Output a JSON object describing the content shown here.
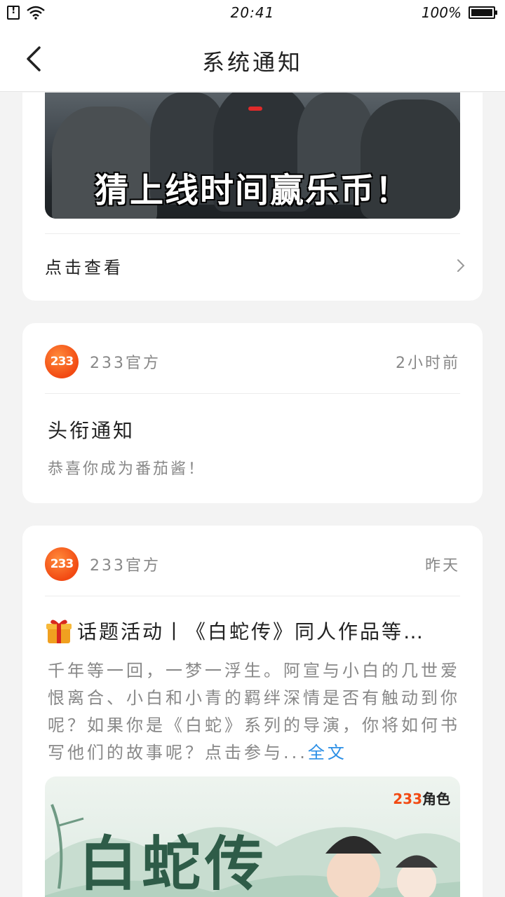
{
  "status_bar": {
    "time": "20:41",
    "battery": "100%"
  },
  "header": {
    "title": "系统通知"
  },
  "card1": {
    "banner_caption": "猜上线时间赢乐币！",
    "view_label": "点击查看"
  },
  "messages": [
    {
      "logo": "233",
      "sender": "233官方",
      "time": "2小时前",
      "title": "头衔通知",
      "body": "恭喜你成为番茄酱！"
    },
    {
      "logo": "233",
      "sender": "233官方",
      "time": "昨天",
      "title": "话题活动丨《白蛇传》同人作品等…",
      "body": "千年等一回，一梦一浮生。阿宣与小白的几世爱恨离合、小白和小青的羁绊深情是否有触动到你呢？如果你是《白蛇》系列的导演，你将如何书写他们的故事呢？点击参与...",
      "fulltext_label": "全文",
      "banner_brand_num": "233",
      "banner_brand_txt": "角色",
      "banner_text": "白蛇传"
    }
  ],
  "colors": {
    "accent_link": "#2b8fe6",
    "brand_orange": "#f24a13"
  }
}
